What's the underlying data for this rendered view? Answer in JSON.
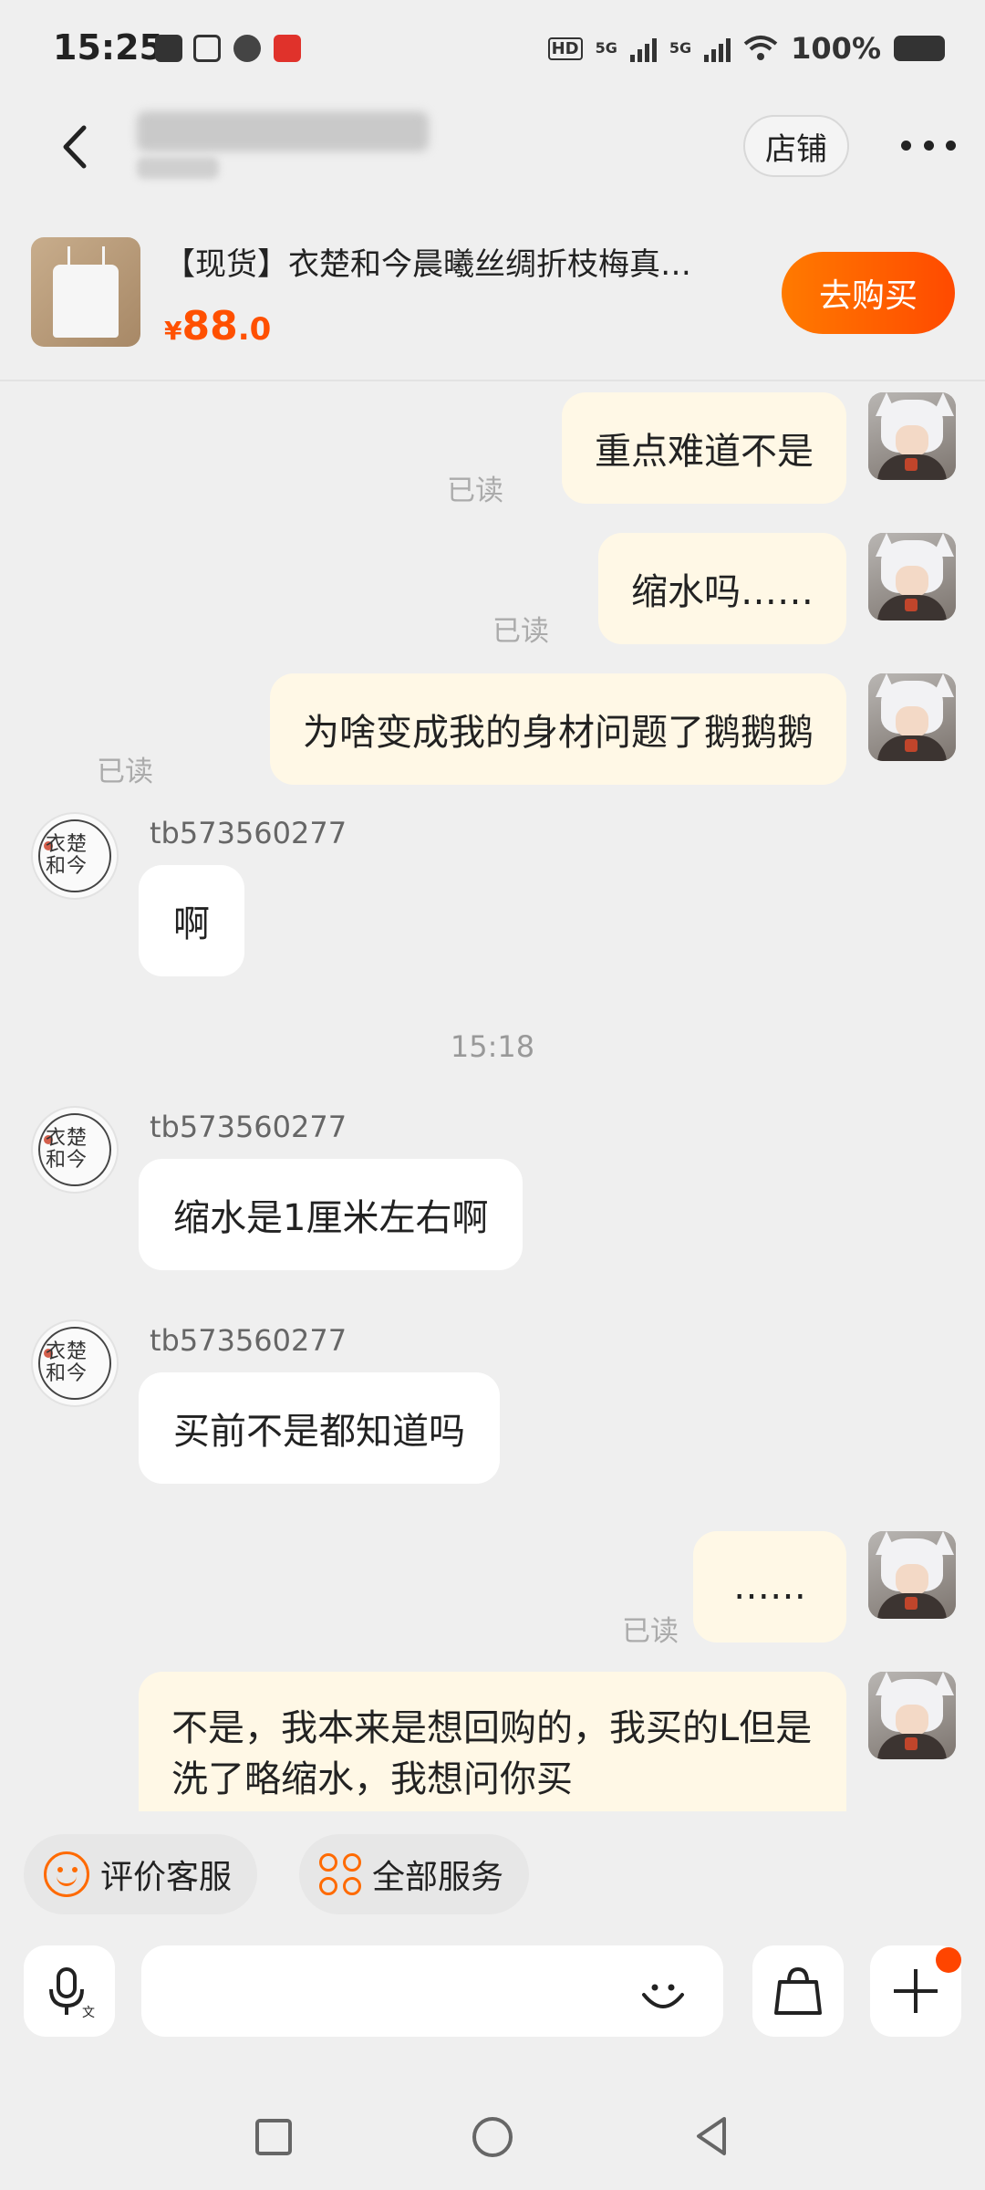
{
  "status_bar": {
    "time": "15:25",
    "hd_label": "HD",
    "network_1": "5G",
    "network_2": "5G",
    "battery": "100%"
  },
  "header": {
    "store_button": "店铺",
    "back_icon": "chevron-left-icon",
    "more_icon": "more-dots-icon"
  },
  "product": {
    "title": "【现货】衣楚和今晨曦丝绸折枝梅真…",
    "price_symbol": "¥",
    "price_int": "88",
    "price_dec": ".0",
    "buy_button": "去购买"
  },
  "chat": {
    "read_label": "已读",
    "shop_sender": "tb573560277",
    "messages": [
      {
        "from": "me",
        "text": "重点难道不是"
      },
      {
        "from": "me",
        "text": "缩水吗……"
      },
      {
        "from": "me",
        "text": "为啥变成我的身材问题了鹅鹅鹅"
      },
      {
        "from": "shop",
        "text": "啊"
      },
      {
        "from": "shop",
        "text": "缩水是1厘米左右啊"
      },
      {
        "from": "shop",
        "text": "买前不是都知道吗"
      },
      {
        "from": "me",
        "text": "……"
      },
      {
        "from": "me",
        "text": "不是，我本来是想回购的，我买的L但是洗了略缩水，我想问你买"
      }
    ],
    "timestamp": "15:18"
  },
  "quick_actions": {
    "rate_service": "评价客服",
    "all_services": "全部服务"
  },
  "input": {
    "placeholder": ""
  },
  "colors": {
    "accent": "#ff5000",
    "my_bubble": "#fff8e6",
    "other_bubble": "#ffffff",
    "background": "#efefef"
  }
}
